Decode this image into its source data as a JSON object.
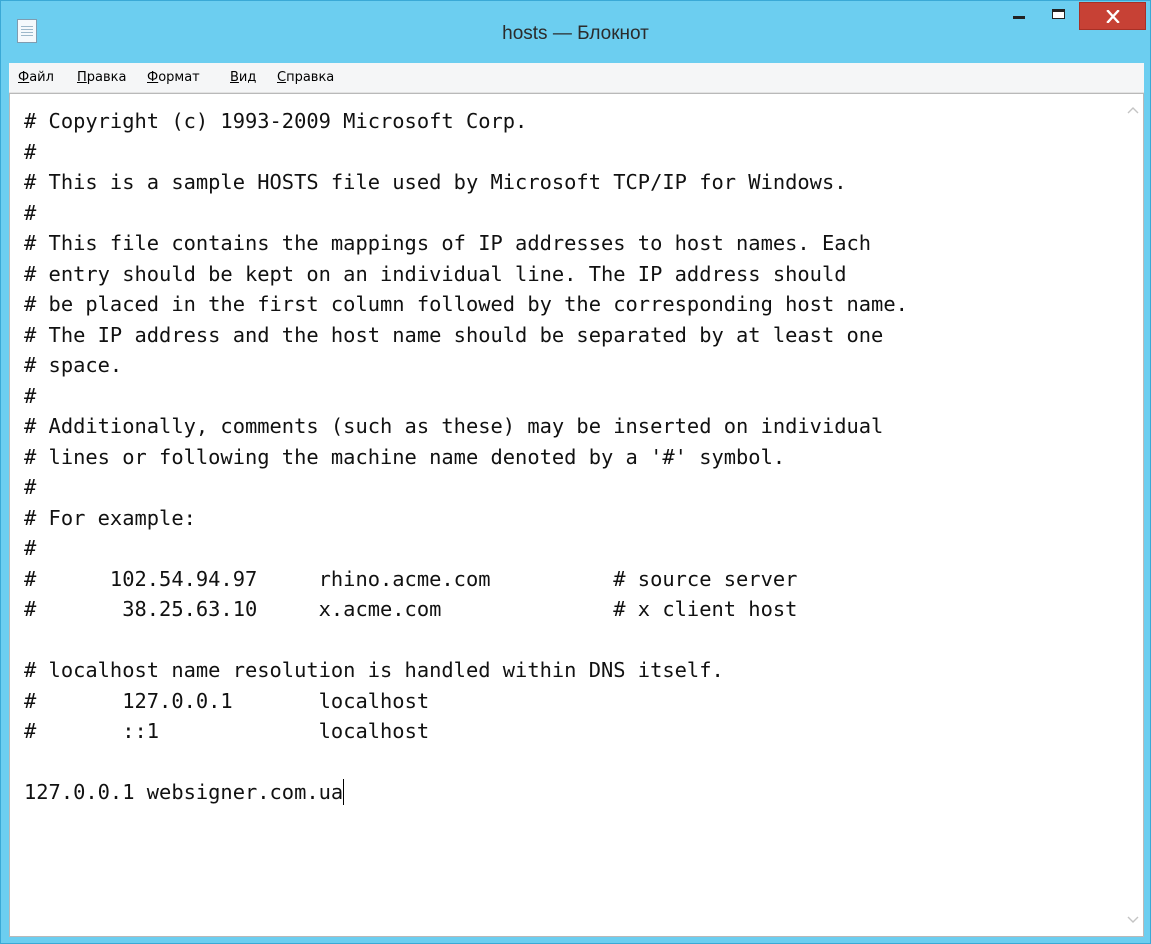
{
  "window": {
    "title": "hosts — Блокнот",
    "icon": "notepad-icon",
    "close_glyph": "×"
  },
  "menu": {
    "file": "Файл",
    "edit": "Правка",
    "format": "Формат",
    "view": "Вид",
    "help": "Справка"
  },
  "document": {
    "content": "# Copyright (c) 1993-2009 Microsoft Corp.\n#\n# This is a sample HOSTS file used by Microsoft TCP/IP for Windows.\n#\n# This file contains the mappings of IP addresses to host names. Each\n# entry should be kept on an individual line. The IP address should\n# be placed in the first column followed by the corresponding host name.\n# The IP address and the host name should be separated by at least one\n# space.\n#\n# Additionally, comments (such as these) may be inserted on individual\n# lines or following the machine name denoted by a '#' symbol.\n#\n# For example:\n#\n#      102.54.94.97     rhino.acme.com          # source server\n#       38.25.63.10     x.acme.com              # x client host\n\n# localhost name resolution is handled within DNS itself.\n#\t127.0.0.1       localhost\n#\t::1             localhost\n\n127.0.0.1 websigner.com.ua"
  },
  "colors": {
    "title_bar": "#6ccef0",
    "close_button": "#c74135"
  }
}
